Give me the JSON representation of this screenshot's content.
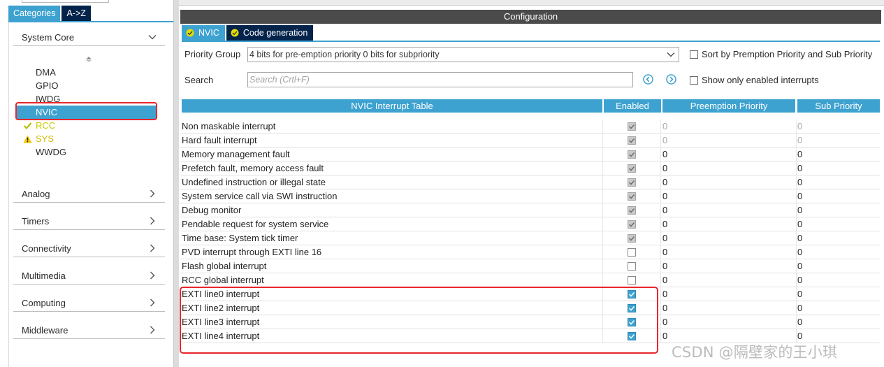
{
  "left": {
    "tabs": [
      {
        "label": "Categories",
        "active": true
      },
      {
        "label": "A->Z",
        "active": false
      }
    ],
    "categories": [
      {
        "label": "System Core",
        "expanded": true
      },
      {
        "label": "Analog"
      },
      {
        "label": "Timers"
      },
      {
        "label": "Connectivity"
      },
      {
        "label": "Multimedia"
      },
      {
        "label": "Computing"
      },
      {
        "label": "Middleware"
      }
    ],
    "system_core_items": [
      {
        "label": "DMA",
        "state": "none"
      },
      {
        "label": "GPIO",
        "state": "none"
      },
      {
        "label": "IWDG",
        "state": "none"
      },
      {
        "label": "NVIC",
        "state": "selected"
      },
      {
        "label": "RCC",
        "state": "ok",
        "icon": "check-icon"
      },
      {
        "label": "SYS",
        "state": "warning",
        "icon": "warning-icon"
      },
      {
        "label": "WWDG",
        "state": "none"
      }
    ]
  },
  "right": {
    "title": "Configuration",
    "tabs": [
      {
        "label": "NVIC",
        "active": true,
        "icon": "check-circle-icon"
      },
      {
        "label": "Code generation",
        "active": false,
        "icon": "check-circle-icon"
      }
    ],
    "priority_group": {
      "label": "Priority Group",
      "value": "4 bits for pre-emption priority 0 bits for subpriority"
    },
    "sort_option": {
      "label": "Sort by Premption Priority and Sub Priority",
      "checked": false
    },
    "search": {
      "label": "Search",
      "placeholder": "Search (Crtl+F)"
    },
    "show_enabled_option": {
      "label": "Show only enabled interrupts",
      "checked": false
    },
    "table": {
      "headers": {
        "name": "NVIC Interrupt Table",
        "enabled": "Enabled",
        "preemption": "Preemption Priority",
        "sub": "Sub Priority"
      },
      "rows": [
        {
          "name": "Non maskable interrupt",
          "enabled": true,
          "locked": true,
          "preemption": "0",
          "sub": "0",
          "priority_editable": false
        },
        {
          "name": "Hard fault interrupt",
          "enabled": true,
          "locked": true,
          "preemption": "0",
          "sub": "0",
          "priority_editable": false
        },
        {
          "name": "Memory management fault",
          "enabled": true,
          "locked": true,
          "preemption": "0",
          "sub": "0",
          "priority_editable": true
        },
        {
          "name": "Prefetch fault, memory access fault",
          "enabled": true,
          "locked": true,
          "preemption": "0",
          "sub": "0",
          "priority_editable": true
        },
        {
          "name": "Undefined instruction or illegal state",
          "enabled": true,
          "locked": true,
          "preemption": "0",
          "sub": "0",
          "priority_editable": true
        },
        {
          "name": "System service call via SWI instruction",
          "enabled": true,
          "locked": true,
          "preemption": "0",
          "sub": "0",
          "priority_editable": true
        },
        {
          "name": "Debug monitor",
          "enabled": true,
          "locked": true,
          "preemption": "0",
          "sub": "0",
          "priority_editable": true
        },
        {
          "name": "Pendable request for system service",
          "enabled": true,
          "locked": true,
          "preemption": "0",
          "sub": "0",
          "priority_editable": true
        },
        {
          "name": "Time base: System tick timer",
          "enabled": true,
          "locked": true,
          "preemption": "0",
          "sub": "0",
          "priority_editable": true
        },
        {
          "name": "PVD interrupt through EXTI line 16",
          "enabled": false,
          "locked": false,
          "preemption": "0",
          "sub": "0",
          "priority_editable": true
        },
        {
          "name": "Flash global interrupt",
          "enabled": false,
          "locked": false,
          "preemption": "0",
          "sub": "0",
          "priority_editable": true
        },
        {
          "name": "RCC global interrupt",
          "enabled": false,
          "locked": false,
          "preemption": "0",
          "sub": "0",
          "priority_editable": true
        },
        {
          "name": "EXTI line0 interrupt",
          "enabled": true,
          "locked": false,
          "preemption": "0",
          "sub": "0",
          "priority_editable": true
        },
        {
          "name": "EXTI line2 interrupt",
          "enabled": true,
          "locked": false,
          "preemption": "0",
          "sub": "0",
          "priority_editable": true
        },
        {
          "name": "EXTI line3 interrupt",
          "enabled": true,
          "locked": false,
          "preemption": "0",
          "sub": "0",
          "priority_editable": true
        },
        {
          "name": "EXTI line4 interrupt",
          "enabled": true,
          "locked": false,
          "preemption": "0",
          "sub": "0",
          "priority_editable": true
        }
      ]
    }
  },
  "watermark": "CSDN @隔壁家的王小琪",
  "colors": {
    "accent": "#3ea2d0",
    "dark_tab": "#03234b",
    "title_bar": "#4b4b4b",
    "highlight_red": "#e8262b"
  }
}
